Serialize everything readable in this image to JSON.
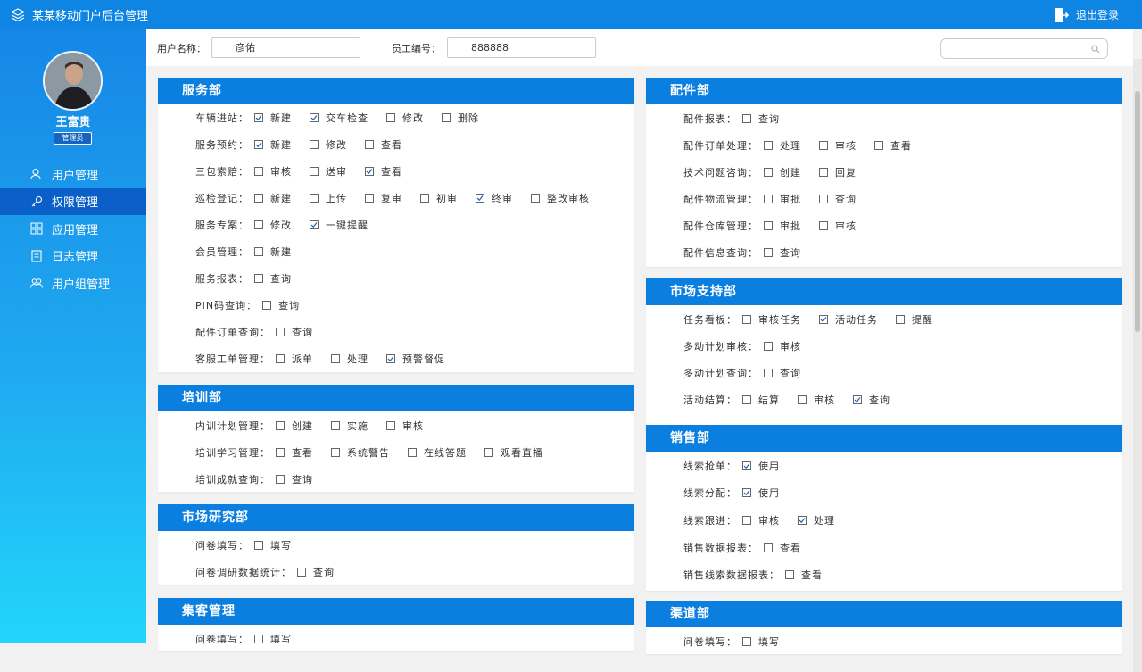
{
  "app": {
    "title": "某某移动门户后台管理",
    "logout_label": "退出登录"
  },
  "user": {
    "name": "王富贵",
    "role": "管理员"
  },
  "menu": [
    {
      "label": "用户管理",
      "icon": "users-icon",
      "active": false
    },
    {
      "label": "权限管理",
      "icon": "key-icon",
      "active": true
    },
    {
      "label": "应用管理",
      "icon": "apps-icon",
      "active": false
    },
    {
      "label": "日志管理",
      "icon": "log-icon",
      "active": false
    },
    {
      "label": "用户组管理",
      "icon": "group-icon",
      "active": false
    }
  ],
  "filter": {
    "username_label": "用户名称：",
    "username_value": "彦佑",
    "empno_label": "员工编号：",
    "empno_value": "888888",
    "search_placeholder": ""
  },
  "sections": [
    {
      "title": "服务部",
      "rows": [
        {
          "label": "车辆进站：",
          "options": [
            {
              "label": "新建",
              "checked": true
            },
            {
              "label": "交车检查",
              "checked": true
            },
            {
              "label": "修改",
              "checked": false
            },
            {
              "label": "删除",
              "checked": false
            }
          ]
        },
        {
          "label": "服务预约：",
          "options": [
            {
              "label": "新建",
              "checked": true
            },
            {
              "label": "修改",
              "checked": false
            },
            {
              "label": "查看",
              "checked": false
            }
          ]
        },
        {
          "label": "三包索赔：",
          "options": [
            {
              "label": "审核",
              "checked": false
            },
            {
              "label": "送审",
              "checked": false
            },
            {
              "label": "查看",
              "checked": true
            }
          ]
        },
        {
          "label": "巡检登记：",
          "options": [
            {
              "label": "新建",
              "checked": false
            },
            {
              "label": "上传",
              "checked": false
            },
            {
              "label": "复审",
              "checked": false
            },
            {
              "label": "初审",
              "checked": false
            },
            {
              "label": "终审",
              "checked": true
            },
            {
              "label": "整改审核",
              "checked": false
            }
          ]
        },
        {
          "label": "服务专案：",
          "options": [
            {
              "label": "修改",
              "checked": false
            },
            {
              "label": "一键提醒",
              "checked": true
            }
          ]
        },
        {
          "label": "会员管理：",
          "options": [
            {
              "label": "新建",
              "checked": false
            }
          ]
        },
        {
          "label": "服务报表：",
          "options": [
            {
              "label": "查询",
              "checked": false
            }
          ]
        },
        {
          "label": "PIN码查询：",
          "options": [
            {
              "label": "查询",
              "checked": false
            }
          ]
        },
        {
          "label": "配件订单查询：",
          "options": [
            {
              "label": "查询",
              "checked": false
            }
          ]
        },
        {
          "label": "客服工单管理：",
          "options": [
            {
              "label": "派单",
              "checked": false
            },
            {
              "label": "处理",
              "checked": false
            },
            {
              "label": "预警督促",
              "checked": true
            }
          ]
        }
      ]
    },
    {
      "title": "培训部",
      "rows": [
        {
          "label": "内训计划管理：",
          "options": [
            {
              "label": "创建",
              "checked": false
            },
            {
              "label": "实施",
              "checked": false
            },
            {
              "label": "审核",
              "checked": false
            }
          ]
        },
        {
          "label": "培训学习管理：",
          "options": [
            {
              "label": "查看",
              "checked": false
            },
            {
              "label": "系统警告",
              "checked": false
            },
            {
              "label": "在线答题",
              "checked": false
            },
            {
              "label": "观看直播",
              "checked": false
            }
          ]
        },
        {
          "label": "培训成就查询：",
          "options": [
            {
              "label": "查询",
              "checked": false
            }
          ]
        }
      ]
    },
    {
      "title": "市场研究部",
      "rows": [
        {
          "label": "问卷填写：",
          "options": [
            {
              "label": "填写",
              "checked": false
            }
          ]
        },
        {
          "label": "问卷调研数据统计：",
          "options": [
            {
              "label": "查询",
              "checked": false
            }
          ]
        }
      ]
    },
    {
      "title": "集客管理",
      "rows": [
        {
          "label": "问卷填写：",
          "options": [
            {
              "label": "填写",
              "checked": false
            }
          ]
        }
      ]
    },
    {
      "title": "配件部",
      "rows": [
        {
          "label": "配件报表：",
          "options": [
            {
              "label": "查询",
              "checked": false
            }
          ]
        },
        {
          "label": "配件订单处理：",
          "options": [
            {
              "label": "处理",
              "checked": false
            },
            {
              "label": "审核",
              "checked": false
            },
            {
              "label": "查看",
              "checked": false
            }
          ]
        },
        {
          "label": "技术问题咨询：",
          "options": [
            {
              "label": "创建",
              "checked": false
            },
            {
              "label": "回复",
              "checked": false
            }
          ]
        },
        {
          "label": "配件物流管理：",
          "options": [
            {
              "label": "审批",
              "checked": false
            },
            {
              "label": "查询",
              "checked": false
            }
          ]
        },
        {
          "label": "配件仓库管理：",
          "options": [
            {
              "label": "审批",
              "checked": false
            },
            {
              "label": "审核",
              "checked": false
            }
          ]
        },
        {
          "label": "配件信息查询：",
          "options": [
            {
              "label": "查询",
              "checked": false
            }
          ]
        }
      ]
    },
    {
      "title": "市场支持部",
      "rows": [
        {
          "label": "任务看板：",
          "options": [
            {
              "label": "审核任务",
              "checked": false
            },
            {
              "label": "活动任务",
              "checked": true
            },
            {
              "label": "提醒",
              "checked": false
            }
          ]
        },
        {
          "label": "多动计划审核：",
          "options": [
            {
              "label": "审核",
              "checked": false
            }
          ]
        },
        {
          "label": "多动计划查询：",
          "options": [
            {
              "label": "查询",
              "checked": false
            }
          ]
        },
        {
          "label": "活动结算：",
          "options": [
            {
              "label": "结算",
              "checked": false
            },
            {
              "label": "审核",
              "checked": false
            },
            {
              "label": "查询",
              "checked": true
            }
          ]
        }
      ]
    },
    {
      "title": "销售部",
      "rows": [
        {
          "label": "线索抢单：",
          "options": [
            {
              "label": "使用",
              "checked": true
            }
          ]
        },
        {
          "label": "线索分配：",
          "options": [
            {
              "label": "使用",
              "checked": true
            }
          ]
        },
        {
          "label": "线索跟进：",
          "options": [
            {
              "label": "审核",
              "checked": false
            },
            {
              "label": "处理",
              "checked": true
            }
          ]
        },
        {
          "label": "销售数据报表：",
          "options": [
            {
              "label": "查看",
              "checked": false
            }
          ]
        },
        {
          "label": "销售线索数据报表：",
          "options": [
            {
              "label": "查看",
              "checked": false
            }
          ]
        }
      ]
    },
    {
      "title": "渠道部",
      "rows": [
        {
          "label": "问卷填写：",
          "options": [
            {
              "label": "填写",
              "checked": false
            }
          ]
        }
      ]
    }
  ]
}
